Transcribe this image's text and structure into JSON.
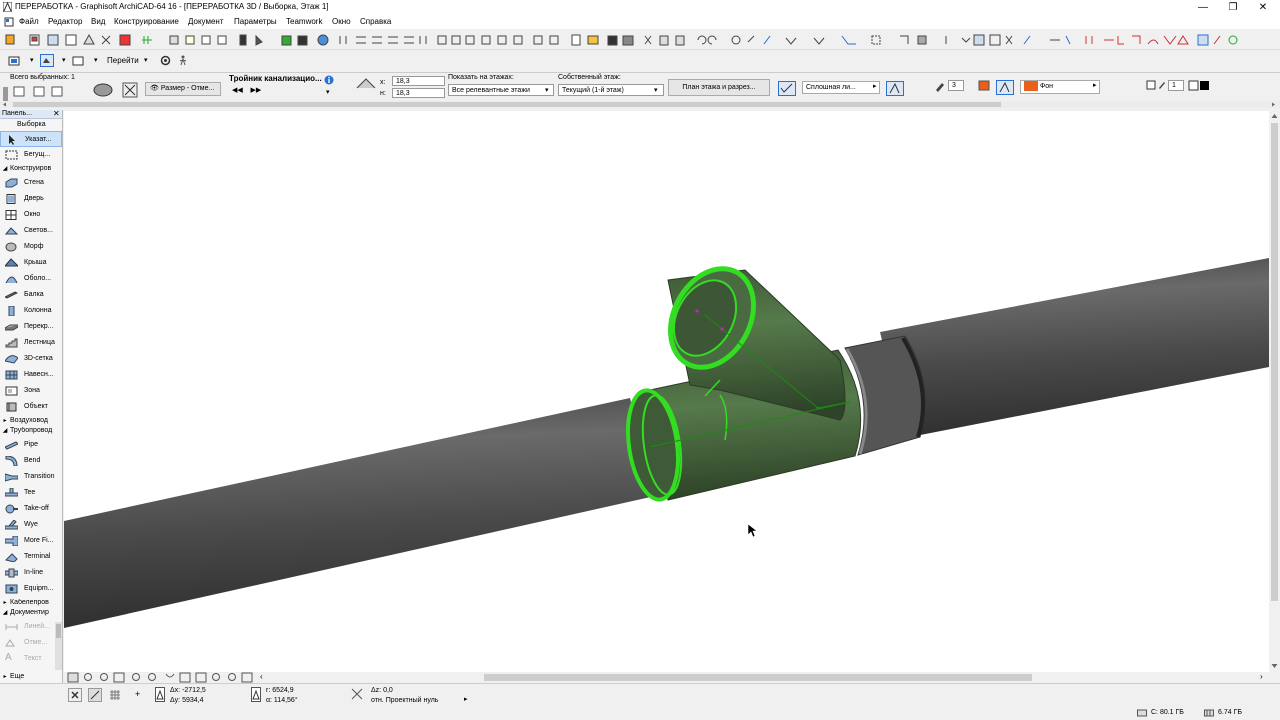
{
  "window": {
    "title": "ПЕРЕРАБОТКА - Graphisoft ArchiCAD-64 16 - [ПЕРЕРАБОТКА 3D / Выборка, Этаж 1]",
    "minimize": "—",
    "restore": "❐",
    "close": "✕"
  },
  "menu": [
    "Файл",
    "Редактор",
    "Вид",
    "Конструирование",
    "Документ",
    "Параметры",
    "Teamwork",
    "Окно",
    "Справка"
  ],
  "toolbar2": {
    "goto_label": "Перейти"
  },
  "infobox": {
    "selected_count": "Всего выбранных: 1",
    "dimension_mode": "Размер - Отме...",
    "element_name": "Тройник канализацио...",
    "value1": "18,3",
    "value2": "18,3",
    "show_on_stories_label": "Показать на этажах:",
    "show_on_stories_value": "Все релевантные этажи",
    "home_story_label": "Собственный этаж:",
    "home_story_value": "Текущий (1-й этаж)",
    "floor_plan_button": "План этажа и разрез...",
    "line_type": "Сплошная ли...",
    "pen_number": "3",
    "background_label": "Фон",
    "pen_number2": "1",
    "colors": {
      "pen_orange": "#e8601c",
      "background": "#e8601c"
    }
  },
  "toolbox": {
    "title": "Панель...",
    "select_group": "Выборка",
    "arrow_tool": "Указат...",
    "marquee_tool": "Бегущ...",
    "construct_group": "Конструиров",
    "construct_tools": [
      "Стена",
      "Дверь",
      "Окно",
      "Светов...",
      "Морф",
      "Крыша",
      "Оболо...",
      "Балка",
      "Колонна",
      "Перекр...",
      "Лестница",
      "3D-сетка",
      "Навесн...",
      "Зона",
      "Объект"
    ],
    "ducts_group": "Воздуховод",
    "piping_group": "Трубопровод",
    "piping_tools": [
      "Pipe",
      "Bend",
      "Transition",
      "Tee",
      "Take-off",
      "Wye",
      "More Fi...",
      "Terminal",
      "In-line",
      "Equipm..."
    ],
    "cable_group": "Кабелепров",
    "document_group": "Документир",
    "document_tools": [
      "Линей...",
      "Отме...",
      "Текст"
    ],
    "more": "Еще"
  },
  "statusbar": {
    "dx": "Δx: -2712,5",
    "dy": "Δy: 5934,4",
    "r": "r: 6524,9",
    "angle": "α: 114,56°",
    "dz": "Δz: 0,0",
    "ref": "отн. Проектный нуль",
    "disk_c": "C: 80.1 ГБ",
    "memory": "6.74 ГБ"
  },
  "scene": {
    "pipe_color": "#5a5a5a",
    "selection_color": "#33dd22"
  }
}
